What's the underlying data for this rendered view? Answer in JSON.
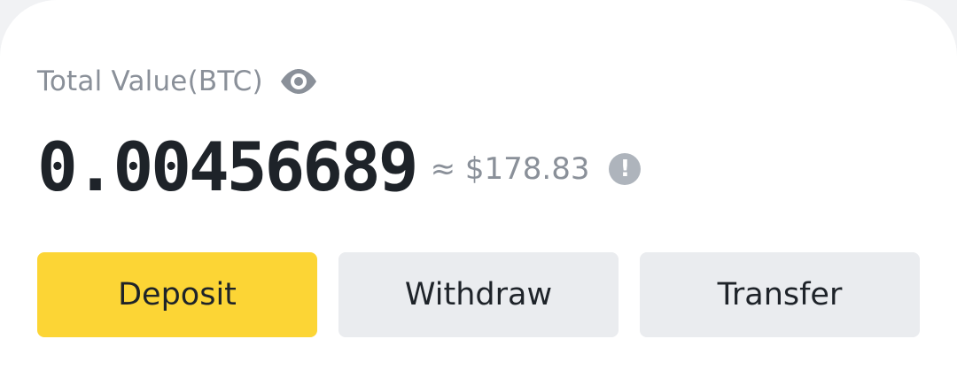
{
  "header": {
    "total_label": "Total Value(BTC)",
    "eye_icon": "eye-icon"
  },
  "balance": {
    "btc": "0.00456689",
    "usd_approx": "≈ $178.83",
    "info_icon": "info-icon"
  },
  "actions": {
    "deposit_label": "Deposit",
    "withdraw_label": "Withdraw",
    "transfer_label": "Transfer"
  },
  "colors": {
    "primary_button": "#fcd535",
    "secondary_button": "#eaecef",
    "text_primary": "#1e2329",
    "text_secondary": "#8a9099"
  }
}
